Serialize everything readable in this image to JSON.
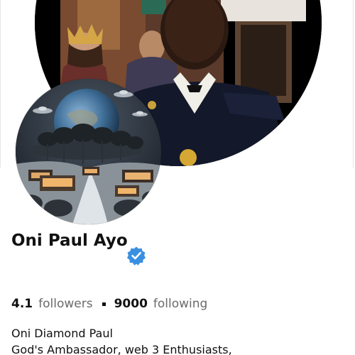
{
  "profile": {
    "display_name": "Oni Paul Ayo",
    "verified": true,
    "verified_icon": "verified-badge-icon",
    "accent_color": "#3a8fe0"
  },
  "stats": {
    "followers_value": "4.1",
    "followers_label": "followers",
    "following_value": "9000",
    "following_label": "following"
  },
  "bio": {
    "line1": "Oni Diamond Paul",
    "line2": "God's Ambassador, web 3 Enthusiasts,"
  }
}
